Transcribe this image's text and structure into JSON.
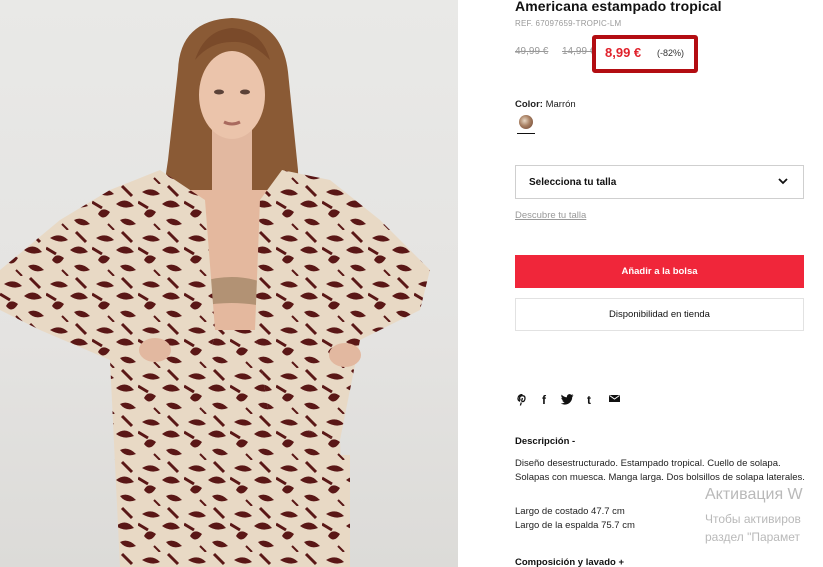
{
  "product": {
    "title": "Americana estampado tropical",
    "ref": "REF. 67097659-TROPIC-LM",
    "old_price_1": "49,99 €",
    "old_price_2": "14,99 €",
    "price_now": "8,99 €",
    "discount": "(-82%)",
    "color_label": "Color:",
    "color_value": "Marrón",
    "size_placeholder": "Selecciona tu talla",
    "size_guide": "Descubre tu talla",
    "add_to_bag": "Añadir a la bolsa",
    "store_availability": "Disponibilidad en tienda",
    "description_heading": "Descripción -",
    "description_text": "Diseño desestructurado. Estampado tropical. Cuello de solapa. Solapas con muesca. Manga larga. Dos bolsillos de solapa laterales.",
    "measure_1": "Largo de costado 47.7 cm",
    "measure_2": "Largo de la espalda 75.7 cm",
    "composition_heading": "Composición y lavado +"
  },
  "share_icons": [
    "pinterest-icon",
    "facebook-icon",
    "twitter-icon",
    "tumblr-icon",
    "email-icon"
  ],
  "share_labels": {
    "facebook": "f",
    "tumblr": "t"
  },
  "watermark": {
    "line1": "Активация W",
    "line2": "Чтобы активиров",
    "line3": "раздел \"Парамет"
  },
  "colors": {
    "accent_red": "#f0263a",
    "price_red": "#e0222c",
    "highlight_box": "#b30d12",
    "print_brown": "#5a1716",
    "print_cream": "#e8d9c5"
  }
}
